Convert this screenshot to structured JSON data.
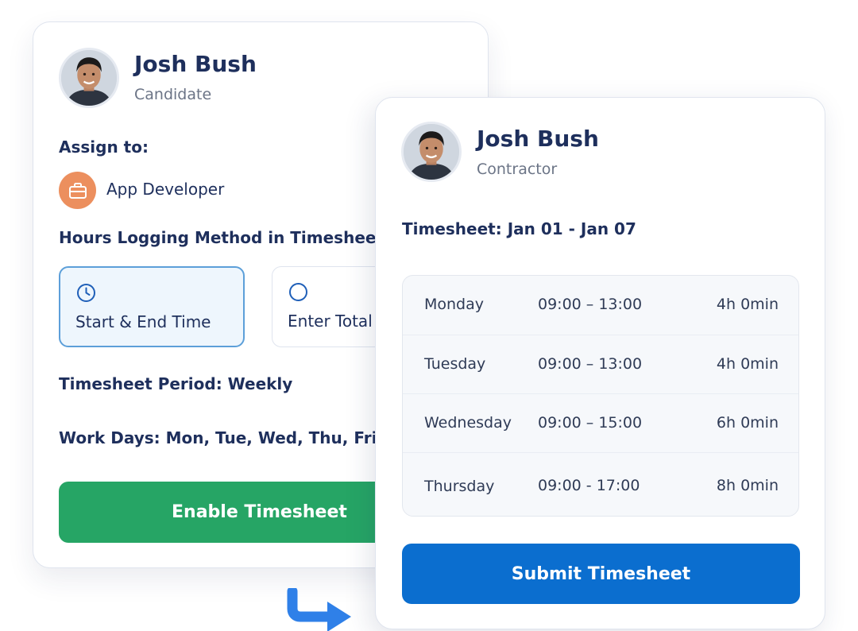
{
  "back_card": {
    "user_name": "Josh Bush",
    "user_role": "Candidate",
    "assign_label": "Assign to:",
    "job_title": "App Developer",
    "hours_method_label": "Hours Logging Method in Timeshee",
    "options": [
      {
        "label": "Start & End Time",
        "icon": "clock-icon",
        "selected": true
      },
      {
        "label": "Enter Total",
        "icon": "radio-icon",
        "selected": false
      }
    ],
    "period_label": "Timesheet Period: Weekly",
    "work_days_label": "Work Days: Mon, Tue, Wed, Thu, Fri, S",
    "enable_button": "Enable Timesheet"
  },
  "front_card": {
    "user_name": "Josh Bush",
    "user_role": "Contractor",
    "timesheet_label": "Timesheet: Jan 01 - Jan 07",
    "rows": [
      {
        "day": "Monday",
        "time": "09:00 – 13:00",
        "total": "4h 0min"
      },
      {
        "day": "Tuesday",
        "time": "09:00 – 13:00",
        "total": "4h 0min"
      },
      {
        "day": "Wednesday",
        "time": "09:00 – 15:00",
        "total": "6h 0min"
      },
      {
        "day": "Thursday",
        "time": "09:00 - 17:00",
        "total": "8h 0min"
      }
    ],
    "submit_button": "Submit Timesheet"
  },
  "colors": {
    "text_primary": "#1e2f5c",
    "enable_green": "#26a565",
    "submit_blue": "#0b6ecf",
    "job_icon_orange": "#ec8f5e",
    "selected_border": "#5c9fd9",
    "arrow_blue": "#2f80e8"
  }
}
